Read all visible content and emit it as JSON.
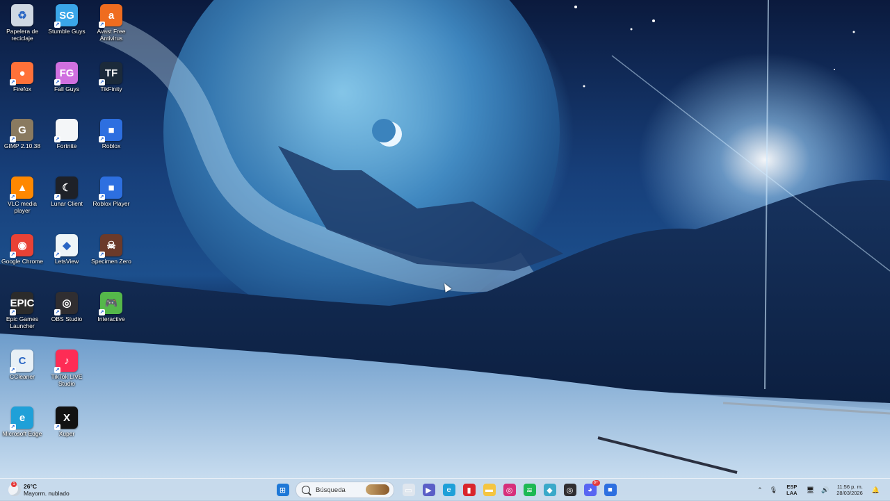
{
  "desktop": {
    "icons": [
      {
        "label": "Papelera de reciclaje",
        "icon": "recycle-bin-icon",
        "color": "#cfd8e3",
        "glyph": "♻"
      },
      {
        "label": "Stumble Guys",
        "icon": "stumble-guys-icon",
        "color": "#3aa6e8",
        "glyph": "SG"
      },
      {
        "label": "Avast Free Antivirus",
        "icon": "avast-icon",
        "color": "#ef6c1f",
        "glyph": "a"
      },
      {
        "label": "Firefox",
        "icon": "firefox-icon",
        "color": "#ff7139",
        "glyph": "●"
      },
      {
        "label": "Fall Guys",
        "icon": "fall-guys-icon",
        "color": "#d070e0",
        "glyph": "FG"
      },
      {
        "label": "TikFinity",
        "icon": "tikfinity-icon",
        "color": "#1b2a3a",
        "glyph": "TF"
      },
      {
        "label": "GIMP 2.10.38",
        "icon": "gimp-icon",
        "color": "#8a7a60",
        "glyph": "G"
      },
      {
        "label": "Fortnite",
        "icon": "fortnite-icon",
        "color": "#f4f6f8",
        "glyph": ""
      },
      {
        "label": "Roblox",
        "icon": "roblox-icon",
        "color": "#2d6fe0",
        "glyph": "■"
      },
      {
        "label": "VLC media player",
        "icon": "vlc-icon",
        "color": "#ff8800",
        "glyph": "▲"
      },
      {
        "label": "Lunar Client",
        "icon": "lunar-client-icon",
        "color": "#1e2128",
        "glyph": "☾"
      },
      {
        "label": "Roblox Player",
        "icon": "roblox-player-icon",
        "color": "#2d6fe0",
        "glyph": "■"
      },
      {
        "label": "Google Chrome",
        "icon": "chrome-icon",
        "color": "#e94235",
        "glyph": "◉"
      },
      {
        "label": "LetsView",
        "icon": "letsview-icon",
        "color": "#eef5f8",
        "glyph": "◆"
      },
      {
        "label": "Specimen Zero",
        "icon": "specimen-zero-icon",
        "color": "#6b3a2a",
        "glyph": "☠"
      },
      {
        "label": "Epic Games Launcher",
        "icon": "epic-games-icon",
        "color": "#2b2b2b",
        "glyph": "EPIC"
      },
      {
        "label": "OBS Studio",
        "icon": "obs-icon",
        "color": "#302e31",
        "glyph": "◎"
      },
      {
        "label": "Interactive",
        "icon": "interactive-icon",
        "color": "#55b84a",
        "glyph": "🎮"
      },
      {
        "label": "CCleaner",
        "icon": "ccleaner-icon",
        "color": "#e8f0f6",
        "glyph": "C"
      },
      {
        "label": "TikTok LIVE Studio",
        "icon": "tiktok-live-icon",
        "color": "#fe2c55",
        "glyph": "♪"
      },
      {
        "label": "Microsoft Edge",
        "icon": "edge-icon",
        "color": "#1fa0d8",
        "glyph": "e"
      },
      {
        "label": "Xuper",
        "icon": "xuper-icon",
        "color": "#121212",
        "glyph": "X"
      }
    ]
  },
  "taskbar": {
    "weather": {
      "temp": "26°C",
      "desc": "Mayorm. nublado",
      "badge": "1"
    },
    "search": {
      "placeholder": "Búsqueda"
    },
    "apps": [
      {
        "name": "windows-start-icon",
        "color": "#1e78d7",
        "glyph": "⊞"
      },
      {
        "name": "task-view-icon",
        "color": "#dfe6ee",
        "glyph": "▭"
      },
      {
        "name": "meet-icon",
        "color": "#5b5fc7",
        "glyph": "▶"
      },
      {
        "name": "edge-taskbar-icon",
        "color": "#1fa0d8",
        "glyph": "e"
      },
      {
        "name": "red-app-icon",
        "color": "#d9262c",
        "glyph": "▮"
      },
      {
        "name": "file-explorer-icon",
        "color": "#f4c542",
        "glyph": "▬"
      },
      {
        "name": "instagram-icon",
        "color": "#d6307b",
        "glyph": "◎"
      },
      {
        "name": "spotify-icon",
        "color": "#1db954",
        "glyph": "≋"
      },
      {
        "name": "letsview-taskbar-icon",
        "color": "#3aa9c9",
        "glyph": "◆"
      },
      {
        "name": "obs-taskbar-icon",
        "color": "#302e31",
        "glyph": "◎"
      },
      {
        "name": "discord-icon",
        "color": "#5865f2",
        "glyph": "◕",
        "badge": "8+"
      },
      {
        "name": "roblox-taskbar-icon",
        "color": "#2d6fe0",
        "glyph": "■"
      }
    ],
    "tray": {
      "lang_top": "ESP",
      "lang_bottom": "LAA",
      "time": "11:56 p. m.",
      "date": "28/03/2026"
    }
  }
}
